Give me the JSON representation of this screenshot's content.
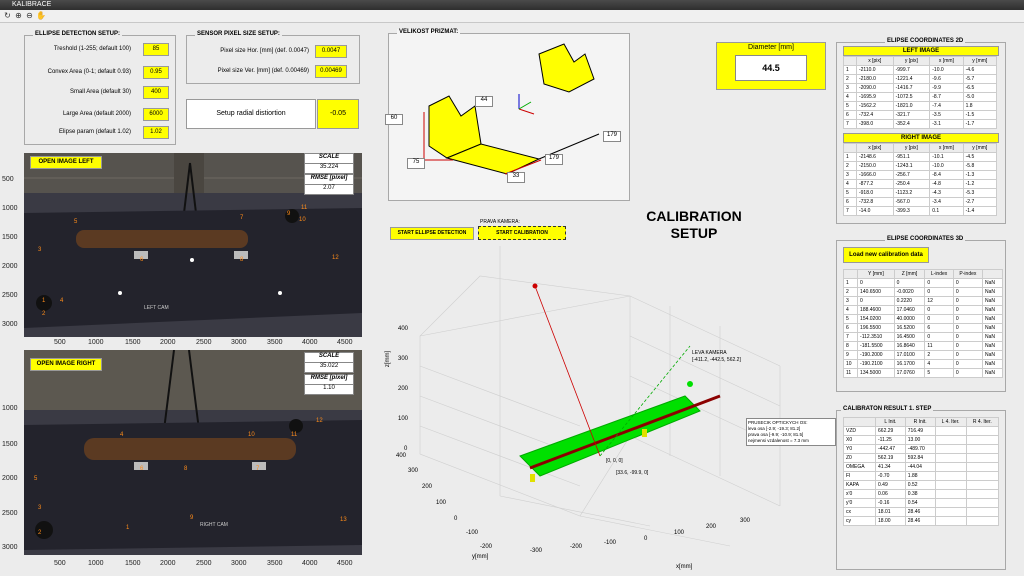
{
  "window": {
    "title": "KALIBRACE"
  },
  "ellipse_setup": {
    "title": "ELLIPSE DETECTION SETUP:",
    "rows": [
      {
        "label": "Treshold (1-255; default 100)",
        "value": "85"
      },
      {
        "label": "Convex Area (0-1; default 0.93)",
        "value": "0.95"
      },
      {
        "label": "Small Area (default 30)",
        "value": "400"
      },
      {
        "label": "Large Area (default 2000)",
        "value": "6000"
      },
      {
        "label": "Elipse param (default 1.02)",
        "value": "1.02"
      }
    ]
  },
  "sensor_setup": {
    "title": "SENSOR PIXEL SIZE SETUP:",
    "rows": [
      {
        "label": "Pixel size Hor. [mm] (def. 0.0047)",
        "value": "0.0047"
      },
      {
        "label": "Pixel size Ver. [mm] (def. 0.00469)",
        "value": "0.00469"
      }
    ]
  },
  "radial": {
    "button": "Setup radial distiortion",
    "value": "-0.05"
  },
  "image_left": {
    "button": "OPEN IMAGE LEFT",
    "scale_label": "SCALE",
    "scale_value": "35.224",
    "rmse_label": "RMSE [pixel]",
    "rmse_value": "2.07",
    "y_ticks": [
      "500",
      "1000",
      "1500",
      "2000",
      "2500",
      "3000"
    ],
    "x_ticks": [
      "500",
      "1000",
      "1500",
      "2000",
      "2500",
      "3000",
      "3500",
      "4000",
      "4500"
    ],
    "annotations": [
      "LEFT CAM"
    ],
    "markers": [
      "5",
      "6",
      "7",
      "8",
      "9",
      "10",
      "11",
      "12",
      "3",
      "2",
      "1",
      "4"
    ]
  },
  "image_right": {
    "button": "OPEN IMAGE RIGHT",
    "scale_label": "SCALE",
    "scale_value": "35.022",
    "rmse_label": "RMSE [pixel]",
    "rmse_value": "1.10",
    "y_ticks": [
      "1000",
      "1500",
      "2000",
      "2500",
      "3000"
    ],
    "x_ticks": [
      "500",
      "1000",
      "1500",
      "2000",
      "2500",
      "3000",
      "3500",
      "4000",
      "4500"
    ],
    "annotations": [
      "RIGHT CAM"
    ],
    "markers": [
      "4",
      "10",
      "11",
      "8",
      "7",
      "6",
      "5",
      "3",
      "2",
      "1",
      "9",
      "12",
      "13"
    ]
  },
  "prizmat": {
    "title": "VELIKOST PRIZMAT:",
    "dims": [
      "60",
      "44",
      "75",
      "33",
      "179",
      "179"
    ]
  },
  "buttons": {
    "ellipse": "START ELLIPSE DETECTION",
    "calibration": "START CALIBRATION",
    "prava_kamera": "PRAVA KAMERA:"
  },
  "calib_title": {
    "line1": "CALIBRATION",
    "line2": "SETUP"
  },
  "diameter": {
    "label": "Diameter [mm]",
    "value": "44.5"
  },
  "plot3d": {
    "zlabel": "z[mm]",
    "ylabel": "y[mm]",
    "xlabel": "x[mm]",
    "z_ticks": [
      "400",
      "300",
      "200",
      "100",
      "0"
    ],
    "y_ticks": [
      "400",
      "300",
      "200",
      "100",
      "0",
      "-100",
      "-200"
    ],
    "x_ticks": [
      "-300",
      "-200",
      "-100",
      "0",
      "100",
      "200",
      "300"
    ],
    "leva_kamera": "LEVA KAMERA",
    "leva_coord": "[-411.2, -442.5, 562.2]",
    "origin_label": "[0, 0, 0]",
    "point_label": "[33.6, -99.9, 0]",
    "prusecik": {
      "title": "PRUSECIK OPTICKYCH OS:",
      "lines": [
        "leva osa     [-2.9; -19.3; 81.2]",
        "prava osa    [-9.9; -10.9; 81.5]",
        "nejmensi vzdalenost = 7.3 mm"
      ]
    }
  },
  "coords2d": {
    "title": "ELIPSE COORDINATES 2D",
    "left_title": "LEFT IMAGE",
    "right_title": "RIGHT IMAGE",
    "headers": [
      "x [pix]",
      "y [pix]",
      "x [mm]",
      "y [mm]"
    ],
    "left_rows": [
      [
        "1",
        "-2110.0",
        "-999.7",
        "-10.0",
        "-4.6"
      ],
      [
        "2",
        "-2180.0",
        "-1221.4",
        "-9.6",
        "-5.7"
      ],
      [
        "3",
        "-2090.0",
        "-1416.7",
        "-9.9",
        "-6.5"
      ],
      [
        "4",
        "-1695.9",
        "-1072.5",
        "-8.7",
        "-5.0"
      ],
      [
        "5",
        "-1562.2",
        "-1821.0",
        "-7.4",
        "1.8"
      ],
      [
        "6",
        "-732.4",
        "-321.7",
        "-3.5",
        "-1.5"
      ],
      [
        "7",
        "-398.0",
        "-352.4",
        "-3.1",
        "-1.7"
      ]
    ],
    "right_rows": [
      [
        "1",
        "-2148.6",
        "-951.1",
        "-10.1",
        "-4.5"
      ],
      [
        "2",
        "-2150.0",
        "-1243.1",
        "-10.0",
        "-5.8"
      ],
      [
        "3",
        "-1666.0",
        "-256.7",
        "-8.4",
        "-1.3"
      ],
      [
        "4",
        "-877.2",
        "-250.4",
        "-4.8",
        "-1.2"
      ],
      [
        "5",
        "-918.0",
        "-1123.2",
        "-4.3",
        "-5.3"
      ],
      [
        "6",
        "-732.8",
        "-567.0",
        "-3.4",
        "-2.7"
      ],
      [
        "7",
        "-14.0",
        "-399.3",
        "0.1",
        "-1.4"
      ]
    ]
  },
  "coords3d": {
    "title": "ELIPSE COORDINATES 3D",
    "load_button": "Load new calibration data",
    "headers": [
      "Y [mm]",
      "Z [mm]",
      "L-index",
      "P-index"
    ],
    "rows": [
      [
        "1",
        "0",
        "0",
        "0",
        "0",
        "NaN"
      ],
      [
        "2",
        "140.6500",
        "-0.0020",
        "0",
        "0",
        "NaN"
      ],
      [
        "3",
        "0",
        "0.2220",
        "12",
        "0",
        "NaN"
      ],
      [
        "4",
        "188.4600",
        "17.0460",
        "0",
        "0",
        "NaN"
      ],
      [
        "5",
        "154.0200",
        "40.0000",
        "0",
        "0",
        "NaN"
      ],
      [
        "6",
        "196.5500",
        "16.5200",
        "6",
        "0",
        "NaN"
      ],
      [
        "7",
        "-112.3510",
        "16.4500",
        "0",
        "0",
        "NaN"
      ],
      [
        "8",
        "-181.5500",
        "16.8640",
        "11",
        "0",
        "NaN"
      ],
      [
        "9",
        "-190.2000",
        "17.0100",
        "2",
        "0",
        "NaN"
      ],
      [
        "10",
        "-190.2100",
        "16.1700",
        "4",
        "0",
        "NaN"
      ],
      [
        "11",
        "134.5000",
        "17.0760",
        "5",
        "0",
        "NaN"
      ]
    ]
  },
  "result": {
    "title": "CALIBRATON RESULT 1. STEP",
    "headers": [
      "",
      "L Init.",
      "R Init.",
      "L 4. Iter.",
      "R 4. Iter."
    ],
    "rows": [
      [
        "VZD",
        "662.29",
        "716.49",
        "",
        ""
      ],
      [
        "X0",
        "-11.25",
        "13.00",
        "",
        ""
      ],
      [
        "Y0",
        "-442.47",
        "-489.70",
        "",
        ""
      ],
      [
        "Z0",
        "562.19",
        "592.84",
        "",
        ""
      ],
      [
        "OMEGA",
        "41.34",
        "-44.04",
        "",
        ""
      ],
      [
        "FI",
        "-0.70",
        "1.88",
        "",
        ""
      ],
      [
        "KAPA",
        "0.49",
        "0.52",
        "",
        ""
      ],
      [
        "x'0",
        "0.06",
        "0.38",
        "",
        ""
      ],
      [
        "y'0",
        "-0.16",
        "0.54",
        "",
        ""
      ],
      [
        "cx",
        "18.01",
        "28.46",
        "",
        ""
      ],
      [
        "cy",
        "18.00",
        "28.46",
        "",
        ""
      ]
    ]
  }
}
